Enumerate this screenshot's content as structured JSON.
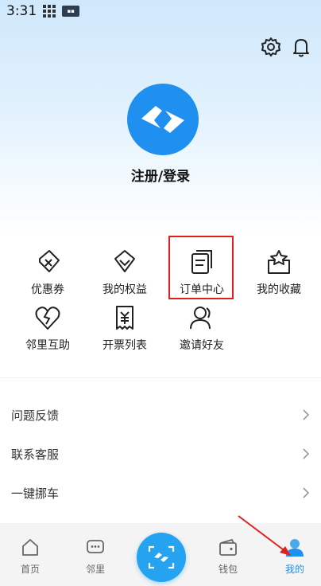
{
  "status_bar": {
    "time": "3:31"
  },
  "profile": {
    "login_label": "注册/登录"
  },
  "grid": [
    {
      "label": "优惠券",
      "icon": "coupon-icon"
    },
    {
      "label": "我的权益",
      "icon": "diamond-icon"
    },
    {
      "label": "订单中心",
      "icon": "orders-icon"
    },
    {
      "label": "我的收藏",
      "icon": "favorites-icon"
    },
    {
      "label": "邻里互助",
      "icon": "heart-broken-icon"
    },
    {
      "label": "开票列表",
      "icon": "invoice-icon"
    },
    {
      "label": "邀请好友",
      "icon": "invite-icon"
    }
  ],
  "list": [
    {
      "label": "问题反馈"
    },
    {
      "label": "联系客服"
    },
    {
      "label": "一键挪车"
    }
  ],
  "nav": [
    {
      "label": "首页",
      "icon": "home-icon"
    },
    {
      "label": "邻里",
      "icon": "chat-icon"
    },
    {
      "label": "钱包",
      "icon": "wallet-icon"
    },
    {
      "label": "我的",
      "icon": "profile-icon"
    }
  ],
  "colors": {
    "brand": "#1f8ff0",
    "accent": "#25a3f0",
    "highlight": "#e02020",
    "active_tab": "#1f8ff0"
  }
}
